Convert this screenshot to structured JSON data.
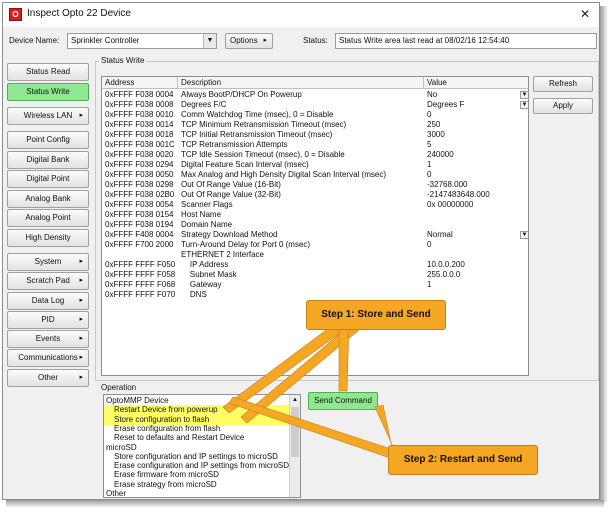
{
  "window": {
    "title": "Inspect Opto 22 Device",
    "close_glyph": "✕",
    "icon_letter": "O"
  },
  "top": {
    "device_name_label": "Device Name:",
    "device_name_value": "Sprinkler Controller",
    "options_label": "Options",
    "status_label": "Status:",
    "status_value": "Status Write area last read at 08/02/16 12:54:40"
  },
  "sidebar": [
    {
      "label": "Status Read",
      "caret": ""
    },
    {
      "label": "Status Write",
      "caret": ""
    },
    {
      "label": "Wireless LAN",
      "caret": "▸"
    },
    {
      "label": "Point Config",
      "caret": ""
    },
    {
      "label": "Digital Bank",
      "caret": ""
    },
    {
      "label": "Digital Point",
      "caret": ""
    },
    {
      "label": "Analog Bank",
      "caret": ""
    },
    {
      "label": "Analog Point",
      "caret": ""
    },
    {
      "label": "High Density",
      "caret": ""
    },
    {
      "label": "System",
      "caret": "▸"
    },
    {
      "label": "Scratch Pad",
      "caret": "▸"
    },
    {
      "label": "Data Log",
      "caret": "▸"
    },
    {
      "label": "PID",
      "caret": "▸"
    },
    {
      "label": "Events",
      "caret": "▸"
    },
    {
      "label": "Communications",
      "caret": "▸"
    },
    {
      "label": "Other",
      "caret": "▸"
    }
  ],
  "status_write": {
    "group_title": "Status Write",
    "columns": [
      "Address",
      "Description",
      "Value"
    ],
    "rows": [
      {
        "address": "0xFFFF F038 0004",
        "description": "Always BootP/DHCP On Powerup",
        "value": "No",
        "dropdown": true
      },
      {
        "address": "0xFFFF F038 0008",
        "description": "Degrees F/C",
        "value": "Degrees F",
        "dropdown": true
      },
      {
        "address": "0xFFFF F038 0010",
        "description": "Comm Watchdog Time (msec), 0 = Disable",
        "value": "0",
        "dropdown": false
      },
      {
        "address": "0xFFFF F038 0014",
        "description": "TCP Minimum Retransmission Timeout (msec)",
        "value": "250",
        "dropdown": false
      },
      {
        "address": "0xFFFF F038 0018",
        "description": "TCP Initial Retransmission Timeout (msec)",
        "value": "3000",
        "dropdown": false
      },
      {
        "address": "0xFFFF F038 001C",
        "description": "TCP Retransmission Attempts",
        "value": "5",
        "dropdown": false
      },
      {
        "address": "0xFFFF F038 0020",
        "description": "TCP Idle Session Timeout (msec), 0 = Disable",
        "value": "240000",
        "dropdown": false
      },
      {
        "address": "0xFFFF F038 0294",
        "description": "Digital Feature Scan Interval (msec)",
        "value": "1",
        "dropdown": false
      },
      {
        "address": "0xFFFF F038 0050",
        "description": "Max Analog and High Density Digital Scan Interval (msec)",
        "value": "0",
        "dropdown": false
      },
      {
        "address": "0xFFFF F038 0298",
        "description": "Out Of Range Value (16-Bit)",
        "value": "-32768.000",
        "dropdown": false
      },
      {
        "address": "0xFFFF F038 02B0",
        "description": "Out Of Range Value (32-Bit)",
        "value": "-2147483648.000",
        "dropdown": false
      },
      {
        "address": "0xFFFF F038 0054",
        "description": "Scanner Flags",
        "value": "0x 00000000",
        "dropdown": false
      },
      {
        "address": "0xFFFF F038 0154",
        "description": "Host Name",
        "value": "",
        "dropdown": false
      },
      {
        "address": "0xFFFF F038 0194",
        "description": "Domain Name",
        "value": "",
        "dropdown": false
      },
      {
        "address": "0xFFFF F408 0004",
        "description": "Strategy Download Method",
        "value": "Normal",
        "dropdown": true
      },
      {
        "address": "0xFFFF F700 2000",
        "description": "Turn-Around Delay for Port 0 (msec)",
        "value": "0",
        "dropdown": false
      },
      {
        "address": "",
        "description": "ETHERNET 2 Interface",
        "value": "",
        "dropdown": false
      },
      {
        "address": "0xFFFF FFFF F050",
        "description": "    IP Address",
        "value": "10.0.0.200",
        "dropdown": false
      },
      {
        "address": "0xFFFF FFFF F058",
        "description": "    Subnet Mask",
        "value": "255.0.0.0",
        "dropdown": false
      },
      {
        "address": "0xFFFF FFFF F068",
        "description": "    Gateway",
        "value": "1",
        "dropdown": false
      },
      {
        "address": "0xFFFF FFFF F070",
        "description": "    DNS",
        "value": "",
        "dropdown": false
      }
    ],
    "refresh_label": "Refresh",
    "apply_label": "Apply"
  },
  "operation": {
    "label": "Operation",
    "items": [
      {
        "text": "OptoMMP Device",
        "indent": false,
        "selected": false
      },
      {
        "text": "Restart Device from powerup",
        "indent": true,
        "selected": true
      },
      {
        "text": "Store configuration to flash",
        "indent": true,
        "selected": true
      },
      {
        "text": "Erase configuration from flash",
        "indent": true,
        "selected": false
      },
      {
        "text": "Reset to defaults and Restart Device",
        "indent": true,
        "selected": false
      },
      {
        "text": "microSD",
        "indent": false,
        "selected": false
      },
      {
        "text": "Store configuration and IP settings to microSD",
        "indent": true,
        "selected": false
      },
      {
        "text": "Erase configuration and IP settings from microSD",
        "indent": true,
        "selected": false
      },
      {
        "text": "Erase firmware from microSD",
        "indent": true,
        "selected": false
      },
      {
        "text": "Erase strategy from microSD",
        "indent": true,
        "selected": false
      },
      {
        "text": "Other",
        "indent": false,
        "selected": false
      }
    ],
    "send_label": "Send Command"
  },
  "callouts": {
    "step1": "Step 1: Store and Send",
    "step2": "Step 2: Restart and Send"
  },
  "colors": {
    "active_green": "#8fe88f",
    "callout_orange": "#f5a623",
    "selection_yellow": "#ffff66"
  }
}
